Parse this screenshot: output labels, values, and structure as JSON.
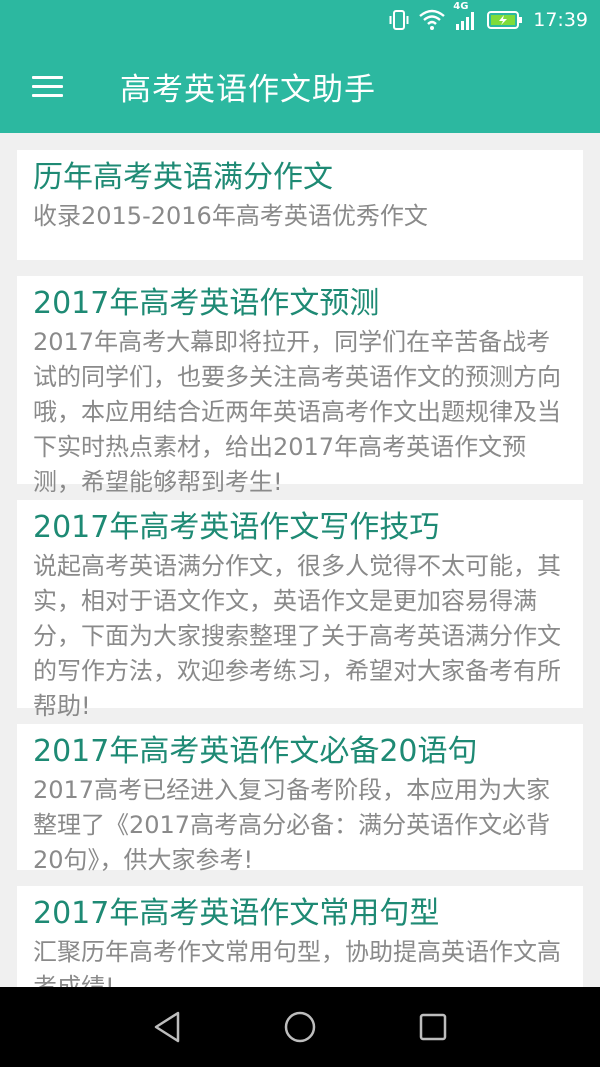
{
  "status_bar": {
    "network": "4G",
    "time": "17:39",
    "icons": [
      "vibrate-icon",
      "wifi-icon",
      "signal-icon",
      "battery-charging-icon"
    ]
  },
  "toolbar": {
    "menu_icon": "hamburger-menu-icon",
    "title": "高考英语作文助手",
    "color": "#2cb8a0"
  },
  "articles": [
    {
      "title": "历年高考英语满分作文",
      "desc": "收录2015-2016年高考英语优秀作文"
    },
    {
      "title": "2017年高考英语作文预测",
      "desc": "2017年高考大幕即将拉开，同学们在辛苦备战考试的同学们，也要多关注高考英语作文的预测方向哦，本应用结合近两年英语高考作文出题规律及当下实时热点素材，给出2017年高考英语作文预测，希望能够帮到考生!"
    },
    {
      "title": "2017年高考英语作文写作技巧",
      "desc": "说起高考英语满分作文，很多人觉得不太可能，其实，相对于语文作文，英语作文是更加容易得满分，下面为大家搜索整理了关于高考英语满分作文的写作方法，欢迎参考练习，希望对大家备考有所帮助!"
    },
    {
      "title": "2017年高考英语作文必备20语句",
      "desc": "2017高考已经进入复习备考阶段，本应用为大家整理了《2017高考高分必备：满分英语作文必背20句》，供大家参考!"
    },
    {
      "title": "2017年高考英语作文常用句型",
      "desc": "汇聚历年高考作文常用句型，协助提高英语作文高考成绩!"
    }
  ],
  "nav_bar": {
    "buttons": [
      "back-icon",
      "home-icon",
      "recents-icon"
    ]
  }
}
